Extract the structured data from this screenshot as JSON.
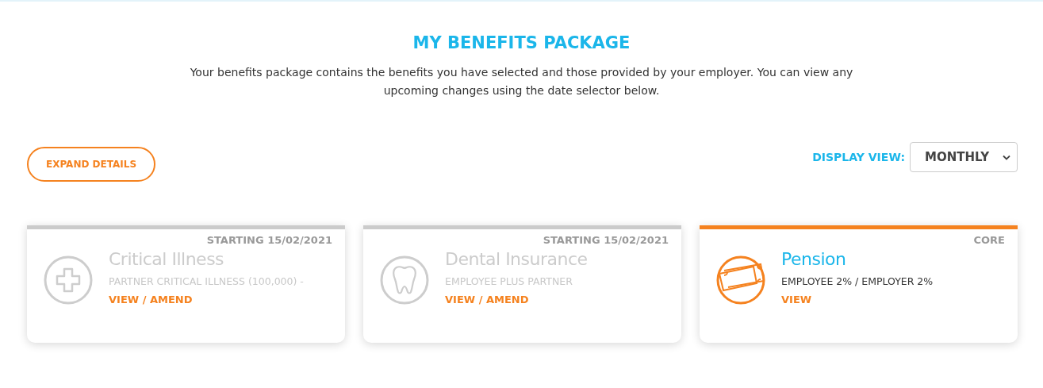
{
  "header": {
    "title": "MY BENEFITS PACKAGE",
    "description": "Your benefits package contains the benefits you have selected and those provided by your employer. You can view any upcoming changes using the date selector below."
  },
  "toolbar": {
    "expand_button": "EXPAND DETAILS",
    "display_view_label": "DISPLAY VIEW:",
    "display_view_value": "MONTHLY"
  },
  "benefits": [
    {
      "kind": "cross",
      "active": false,
      "status": "STARTING 15/02/2021",
      "name": "Critical Illness",
      "detail": "PARTNER CRITICAL ILLNESS (100,000) -",
      "link": "VIEW / AMEND"
    },
    {
      "kind": "tooth",
      "active": false,
      "status": "STARTING 15/02/2021",
      "name": "Dental Insurance",
      "detail": "EMPLOYEE PLUS PARTNER",
      "link": "VIEW / AMEND"
    },
    {
      "kind": "notes",
      "active": true,
      "status": "CORE",
      "name": "Pension",
      "detail": "EMPLOYEE 2% / EMPLOYER 2%",
      "link": "VIEW"
    }
  ]
}
